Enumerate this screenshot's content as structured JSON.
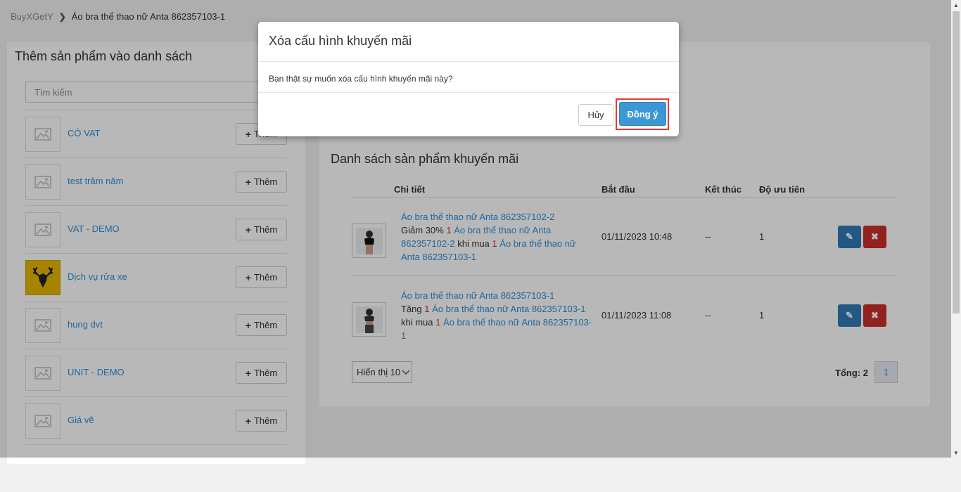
{
  "breadcrumb": {
    "root": "BuyXGetY",
    "current": "Áo bra thể thao nữ Anta 862357103-1"
  },
  "left_panel": {
    "title": "Thêm sản phẩm vào danh sách",
    "search_placeholder": "Tìm kiếm",
    "add_label": "Thêm",
    "products": [
      {
        "name": "CÓ VAT",
        "thumb": "image-placeholder-icon"
      },
      {
        "name": "test trăm năm",
        "thumb": "image-placeholder-icon"
      },
      {
        "name": "VAT - DEMO",
        "thumb": "image-placeholder-icon"
      },
      {
        "name": "Dịch vụ rửa xe",
        "thumb": "deer-logo"
      },
      {
        "name": "hung dvt",
        "thumb": "image-placeholder-icon"
      },
      {
        "name": "UNIT - DEMO",
        "thumb": "image-placeholder-icon"
      },
      {
        "name": "Giá vẽ",
        "thumb": "image-placeholder-icon"
      }
    ]
  },
  "right_panel": {
    "title": "Danh sách sản phẩm khuyến mãi",
    "columns": {
      "detail": "Chi tiết",
      "start": "Bắt đầu",
      "end": "Kết thúc",
      "priority": "Độ ưu tiên"
    },
    "rows": [
      {
        "product_link": "Áo bra thể thao nữ Anta 862357102-2",
        "action": "Giảm 30%",
        "qty_get": "1",
        "get_product": "Áo bra thể thao nữ Anta 862357102-2",
        "when_buy": "khi mua",
        "qty_buy": "1",
        "buy_product": "Áo bra thể thao nữ Anta 862357103-1",
        "start": "01/11/2023 10:48",
        "end": "--",
        "priority": "1"
      },
      {
        "product_link": "Áo bra thể thao nữ Anta 862357103-1",
        "action": "Tặng",
        "qty_get": "1",
        "get_product": "Áo bra thể thao nữ Anta 862357103-1",
        "when_buy": "khi mua",
        "qty_buy": "1",
        "buy_product": "Áo bra thể thao nữ Anta 862357103-1",
        "start": "01/11/2023 11:08",
        "end": "--",
        "priority": "1"
      }
    ],
    "page_size_label": "Hiển thị 10",
    "total_label": "Tổng: 2",
    "current_page": "1"
  },
  "modal": {
    "title": "Xóa cấu hình khuyến mãi",
    "message": "Bạn thật sự muốn xóa cấu hình khuyến mãi này?",
    "cancel_label": "Hủy",
    "confirm_label": "Đồng ý"
  },
  "colors": {
    "link": "#2f8fd8",
    "primary": "#3c97d3",
    "danger": "#c9302c",
    "edit": "#337ab7",
    "highlight": "#e53935"
  }
}
